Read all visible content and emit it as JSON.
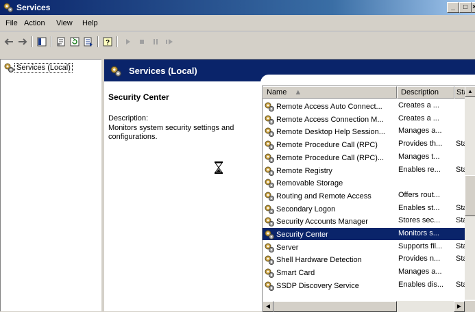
{
  "window": {
    "title": "Services",
    "icon": "services-gear-icon"
  },
  "menu": {
    "items": [
      "File",
      "Action",
      "View",
      "Help"
    ]
  },
  "toolbar": {
    "icons": [
      "back-arrow-icon",
      "forward-arrow-icon",
      "show-hide-tree-icon",
      "properties-icon",
      "refresh-icon",
      "export-list-icon",
      "help-icon",
      "start-service-icon",
      "stop-service-icon",
      "pause-service-icon",
      "restart-service-icon"
    ]
  },
  "tree": {
    "root_label": "Services (Local)"
  },
  "header": {
    "title": "Services (Local)"
  },
  "details": {
    "service_name": "Security Center",
    "description_label": "Description:",
    "description_text": "Monitors system security settings and configurations."
  },
  "list": {
    "columns": [
      "Name",
      "Description",
      "Sta"
    ],
    "rows": [
      {
        "name": "Remote Access Auto Connect...",
        "description": "Creates a ...",
        "status": ""
      },
      {
        "name": "Remote Access Connection M...",
        "description": "Creates a ...",
        "status": ""
      },
      {
        "name": "Remote Desktop Help Session...",
        "description": "Manages a...",
        "status": ""
      },
      {
        "name": "Remote Procedure Call (RPC)",
        "description": "Provides th...",
        "status": "Sta"
      },
      {
        "name": "Remote Procedure Call (RPC)...",
        "description": "Manages t...",
        "status": ""
      },
      {
        "name": "Remote Registry",
        "description": "Enables re...",
        "status": "Sta"
      },
      {
        "name": "Removable Storage",
        "description": "",
        "status": ""
      },
      {
        "name": "Routing and Remote Access",
        "description": "Offers rout...",
        "status": ""
      },
      {
        "name": "Secondary Logon",
        "description": "Enables st...",
        "status": "Sta"
      },
      {
        "name": "Security Accounts Manager",
        "description": "Stores sec...",
        "status": "Sta"
      },
      {
        "name": "Security Center",
        "description": "Monitors s...",
        "status": ""
      },
      {
        "name": "Server",
        "description": "Supports fil...",
        "status": "Sta"
      },
      {
        "name": "Shell Hardware Detection",
        "description": "Provides n...",
        "status": "Sta"
      },
      {
        "name": "Smart Card",
        "description": "Manages a...",
        "status": ""
      },
      {
        "name": "SSDP Discovery Service",
        "description": "Enables dis...",
        "status": "Sta"
      }
    ],
    "selected_index": 10
  },
  "colors": {
    "title_start": "#0a246a",
    "title_end": "#a6caf0",
    "selection": "#0a246a",
    "chrome": "#d4d0c8"
  }
}
